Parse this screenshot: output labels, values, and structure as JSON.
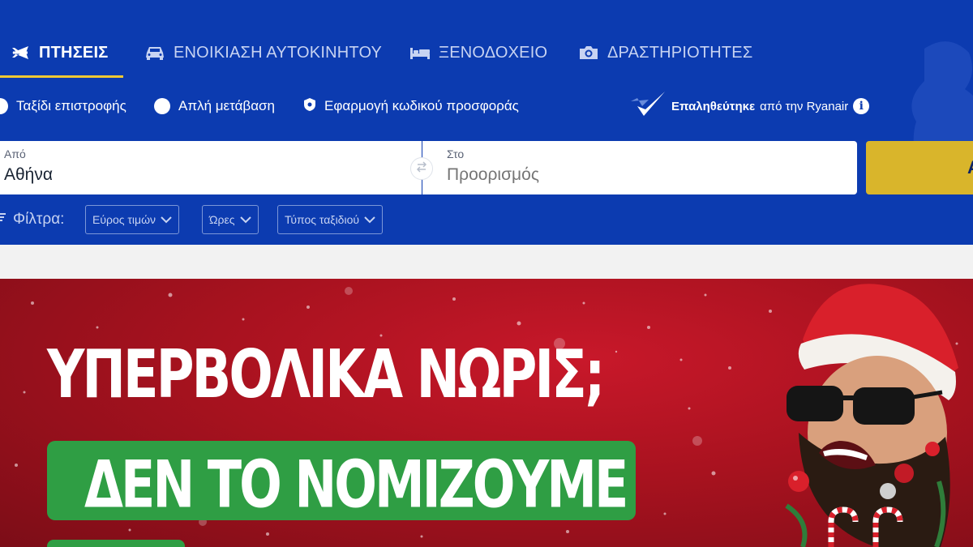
{
  "tabs": [
    {
      "label": "ΠΤΗΣΕΙΣ",
      "icon": "plane-icon",
      "active": true
    },
    {
      "label": "ΕΝΟΙΚΙΑΣΗ ΑΥΤΟΚΙΝΗΤΟΥ",
      "icon": "car-icon",
      "active": false
    },
    {
      "label": "ΞΕΝΟΔΟΧΕΙΟ",
      "icon": "bed-icon",
      "active": false
    },
    {
      "label": "ΔΡΑΣΤΗΡΙΟΤΗΤΕΣ",
      "icon": "camera-icon",
      "active": false
    }
  ],
  "trip_options": {
    "return": "Ταξίδι επιστροφής",
    "one_way": "Απλή μετάβαση",
    "promo": "Εφαρμογή κωδικού προσφοράς"
  },
  "verified": {
    "bold": "Επαληθεύτηκε",
    "rest": "από την Ryanair",
    "info": "i"
  },
  "search": {
    "from_label": "Από",
    "from_value": "Αθήνα",
    "to_label": "Στο",
    "to_placeholder": "Προορισμός",
    "button_label": "Α"
  },
  "filters": {
    "label": "Φίλτρα:",
    "items": [
      "Εύρος τιμών",
      "Ώρες",
      "Τύπος ταξιδιού"
    ]
  },
  "banner": {
    "headline": "ΥΠΕΡΒΟΛΙΚΑ ΝΩΡΙΣ;",
    "subheadline": "ΔΕΝ ΤΟ ΝΟΜΙΖΟΥΜΕ"
  },
  "colors": {
    "header_blue": "#0c3bb0",
    "accent_yellow": "#f1c933",
    "search_button": "#d9b52b",
    "banner_red": "#b3121f",
    "banner_green": "#2f9e44"
  }
}
